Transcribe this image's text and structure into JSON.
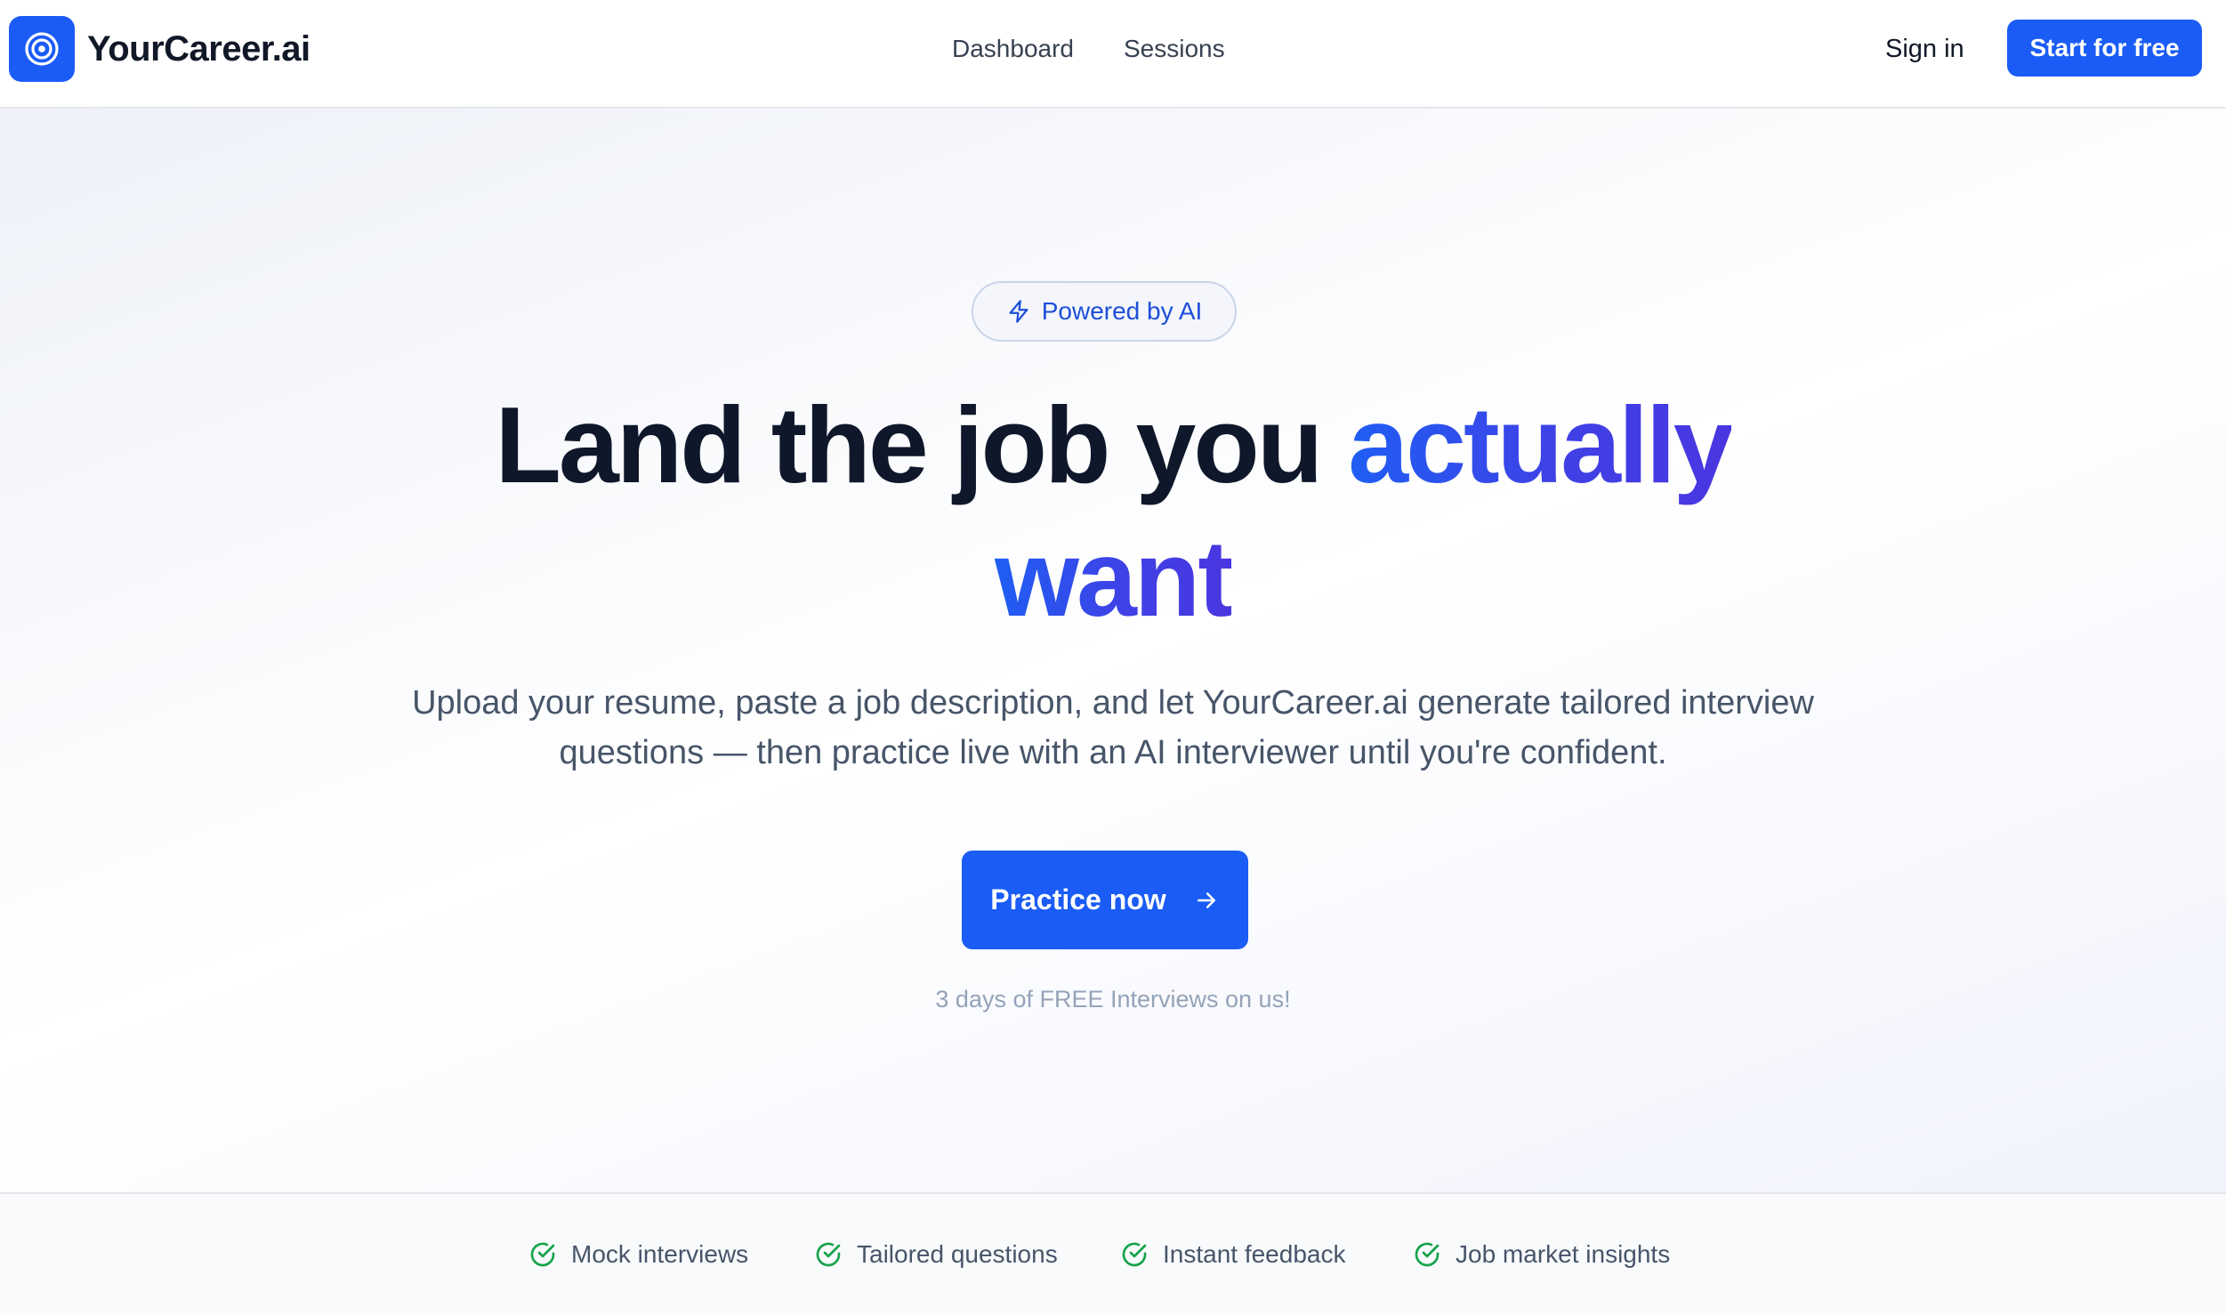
{
  "nav": {
    "brand_name": "YourCareer.ai",
    "links": [
      "Dashboard",
      "Sessions"
    ],
    "sign_in": "Sign in",
    "start_button": "Start for free"
  },
  "hero": {
    "badge": "Powered by AI",
    "headline_main": "Land the job you ",
    "headline_accent_1": "actually",
    "headline_accent_2": "want",
    "subtext": "Upload your resume, paste a job description, and let YourCareer.ai generate tailored interview questions — then practice live with an AI interviewer until you're confident.",
    "cta_label": "Practice now",
    "trial_note": "3 days of FREE Interviews on us!"
  },
  "features": [
    {
      "label": "Mock interviews",
      "icon": "check-circle-icon"
    },
    {
      "label": "Tailored questions",
      "icon": "check-circle-icon"
    },
    {
      "label": "Instant feedback",
      "icon": "check-circle-icon"
    },
    {
      "label": "Job market insights",
      "icon": "check-circle-icon"
    }
  ],
  "colors": {
    "brand_blue": "#1a5cf5",
    "accent_indigo": "#4a36e0",
    "check_green": "#16a34a",
    "heading": "#0f172a",
    "body_text": "#475569"
  }
}
